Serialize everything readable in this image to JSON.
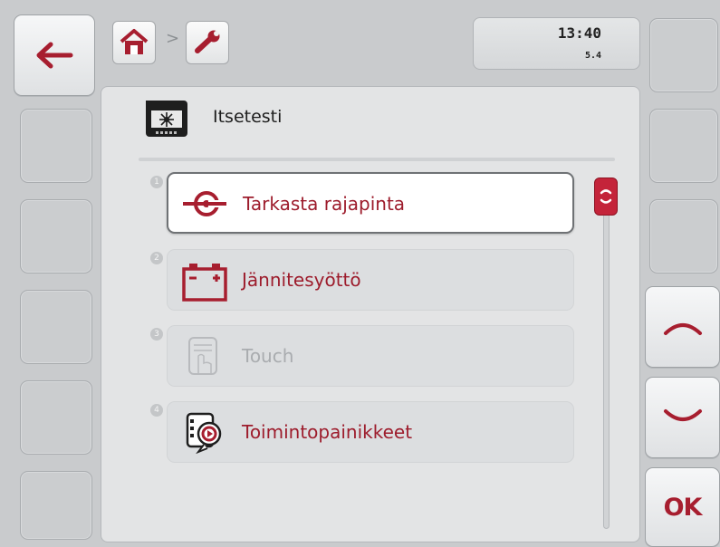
{
  "header": {
    "home_icon": "home-icon",
    "separator": ">",
    "tool_icon": "wrench-icon",
    "time": "13:40",
    "version": "5.4"
  },
  "page": {
    "title": "Itsetesti",
    "title_icon": "terminal-selftest-icon"
  },
  "list": {
    "items": [
      {
        "number": "1",
        "label": "Tarkasta rajapinta",
        "icon": "interface-connector-icon",
        "state": "selected"
      },
      {
        "number": "2",
        "label": "Jännitesyöttö",
        "icon": "battery-icon",
        "state": "normal"
      },
      {
        "number": "3",
        "label": "Touch",
        "icon": "touch-hand-icon",
        "state": "disabled"
      },
      {
        "number": "4",
        "label": "Toimintopainikkeet",
        "icon": "function-keys-icon",
        "state": "normal"
      }
    ]
  },
  "softkeys": {
    "back_icon": "arrow-left-icon",
    "up_icon": "chevron-up-icon",
    "down_icon": "chevron-down-icon",
    "ok_label": "OK"
  },
  "colors": {
    "accent": "#a71e2f",
    "background": "#c9cbcd",
    "panel": "#e3e4e5"
  }
}
